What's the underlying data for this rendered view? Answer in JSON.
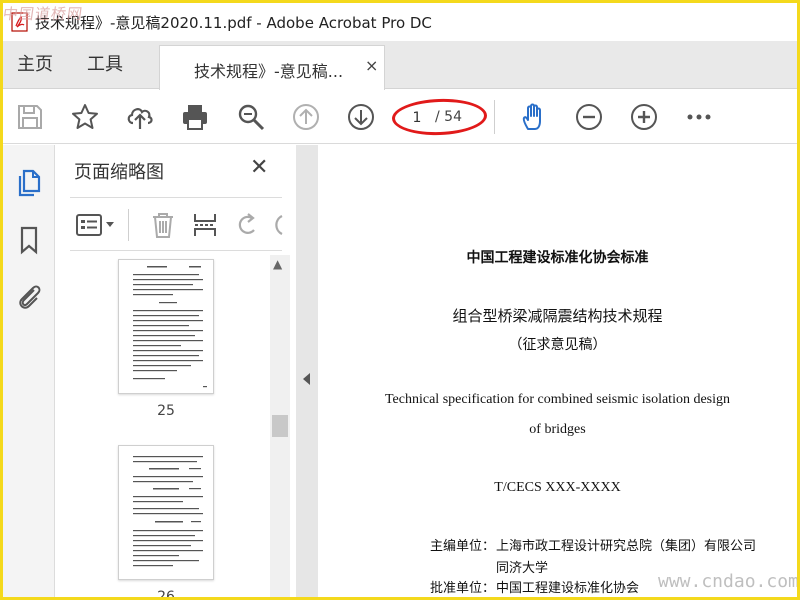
{
  "window": {
    "title": "技术规程》-意见稿2020.11.pdf - Adobe Acrobat Pro DC",
    "watermark_top": "中国道桥网",
    "watermark_bottom": "www.cndao.com"
  },
  "tabs": {
    "home": "主页",
    "tools": "工具",
    "document": "技术规程》-意见稿...",
    "close": "×"
  },
  "toolbar": {
    "save_icon": "save-icon",
    "bookmark_icon": "star-icon",
    "upload_icon": "cloud-upload-icon",
    "print_icon": "print-icon",
    "zoom_icon": "zoom-out-search-icon",
    "prev_icon": "arrow-up-icon",
    "next_icon": "arrow-down-icon",
    "current_page": "1",
    "total_pages": "/ 54",
    "hand_icon": "hand-icon",
    "zoom_out_icon": "minus-circle-icon",
    "zoom_in_icon": "plus-circle-icon",
    "more_icon": "more-icon",
    "accent_color": "#2a6fc9",
    "highlight_color": "#e11a1a"
  },
  "left_rail": {
    "items": [
      "pages-icon",
      "bookmark-ribbon-icon",
      "paperclip-icon"
    ]
  },
  "thumbnail_panel": {
    "title": "页面缩略图",
    "close": "✕",
    "thumbnails": [
      {
        "label": "25"
      },
      {
        "label": "26"
      }
    ]
  },
  "document": {
    "line1": "中国工程建设标准化协会标准",
    "line2": "组合型桥梁减隔震结构技术规程",
    "line3": "（征求意见稿）",
    "line4": "Technical specification for combined seismic isolation design",
    "line5": "of bridges",
    "line6": "T/CECS XXX-XXXX",
    "editor_label": "主编单位：",
    "editor_1": "上海市政工程设计研究总院（集团）有限公司",
    "editor_2": "同济大学",
    "approver_label": "批准单位：",
    "approver": "中国工程建设标准化协会"
  }
}
